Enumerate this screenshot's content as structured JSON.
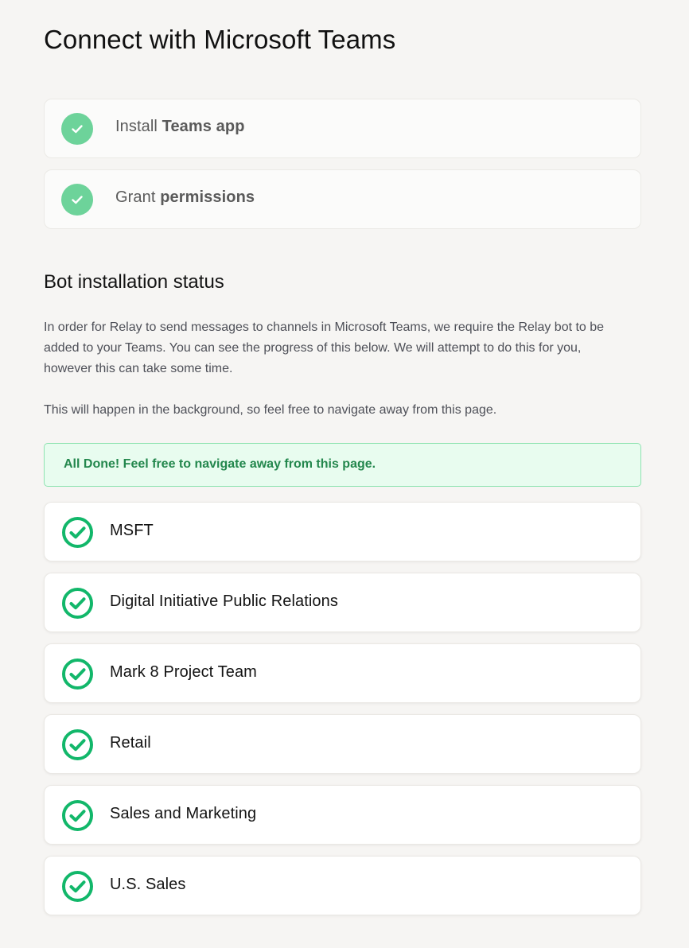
{
  "page": {
    "title": "Connect with Microsoft Teams"
  },
  "steps": [
    {
      "pre": "Install ",
      "strong": "Teams app",
      "icon": "check-circle-icon",
      "status": "complete"
    },
    {
      "pre": "Grant ",
      "strong": "permissions",
      "icon": "check-circle-icon",
      "status": "complete"
    }
  ],
  "bot_section": {
    "title": "Bot installation status",
    "paragraph1": "In order for Relay to send messages to channels in Microsoft Teams, we require the Relay bot to be added to your Teams. You can see the progress of this below. We will attempt to do this for you, however this can take some time.",
    "paragraph2": "This will happen in the background, so feel free to navigate away from this page.",
    "banner": "All Done! Feel free to navigate away from this page."
  },
  "teams": [
    {
      "name": "MSFT",
      "status": "installed",
      "icon": "check-circle-outline-icon"
    },
    {
      "name": "Digital Initiative Public Relations",
      "status": "installed",
      "icon": "check-circle-outline-icon"
    },
    {
      "name": "Mark 8 Project Team",
      "status": "installed",
      "icon": "check-circle-outline-icon"
    },
    {
      "name": "Retail",
      "status": "installed",
      "icon": "check-circle-outline-icon"
    },
    {
      "name": "Sales and Marketing",
      "status": "installed",
      "icon": "check-circle-outline-icon"
    },
    {
      "name": "U.S. Sales",
      "status": "installed",
      "icon": "check-circle-outline-icon"
    }
  ],
  "colors": {
    "background": "#f6f5f3",
    "step_check": "#6dd39a",
    "team_check": "#12b76a",
    "banner_bg": "#e8fcef",
    "banner_border": "#8fe3b1",
    "banner_text": "#23874d"
  }
}
